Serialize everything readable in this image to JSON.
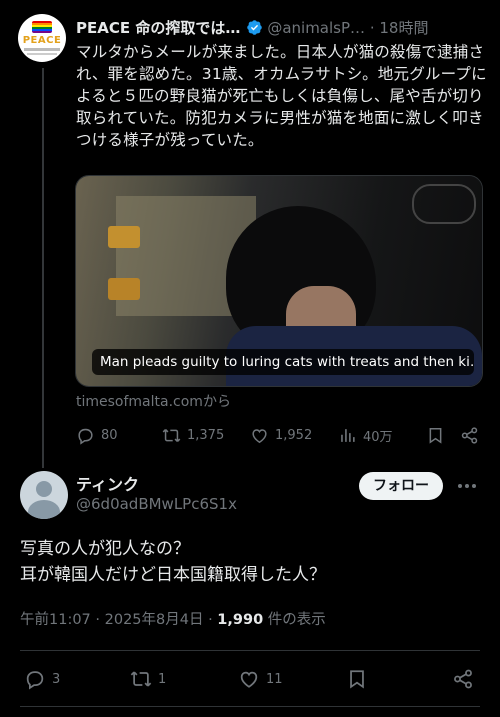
{
  "parent_tweet": {
    "avatar_text": "PEACE",
    "display_name": "PEACE 命の搾取では…",
    "handle": "@animalsP…",
    "separator": "·",
    "time": "18時間",
    "body": "マルタからメールが来ました。日本人が猫の殺傷で逮捕され、罪を認めた。31歳、オカムラサトシ。地元グループによると５匹の野良猫が死亡もしくは負傷し、尾や舌が切り取られていた。防犯カメラに男性が猫を地面に激しく叩きつける様子が残っていた。",
    "media_caption": "Man pleads guilty to luring cats with treats and then ki…",
    "source": "timesofmalta.comから",
    "actions": {
      "replies": "80",
      "reposts": "1,375",
      "likes": "1,952",
      "views": "40万"
    }
  },
  "main_tweet": {
    "display_name": "ティンク",
    "handle": "@6d0adBMwLPc6S1x",
    "follow_label": "フォロー",
    "body_line1": "写真の人が犯人なの？",
    "body_line2": "耳が韓国人だけど日本国籍取得した人？",
    "timestamp": "午前11:07 · 2025年8月4日 · ",
    "view_count": "1,990",
    "view_suffix": " 件の表示",
    "actions": {
      "replies": "3",
      "reposts": "1",
      "likes": "11"
    }
  },
  "colors": {
    "background": "#000000",
    "text": "#e7e9ea",
    "secondary": "#71767b",
    "verified": "#1d9bf0",
    "divider": "#2f3336"
  }
}
